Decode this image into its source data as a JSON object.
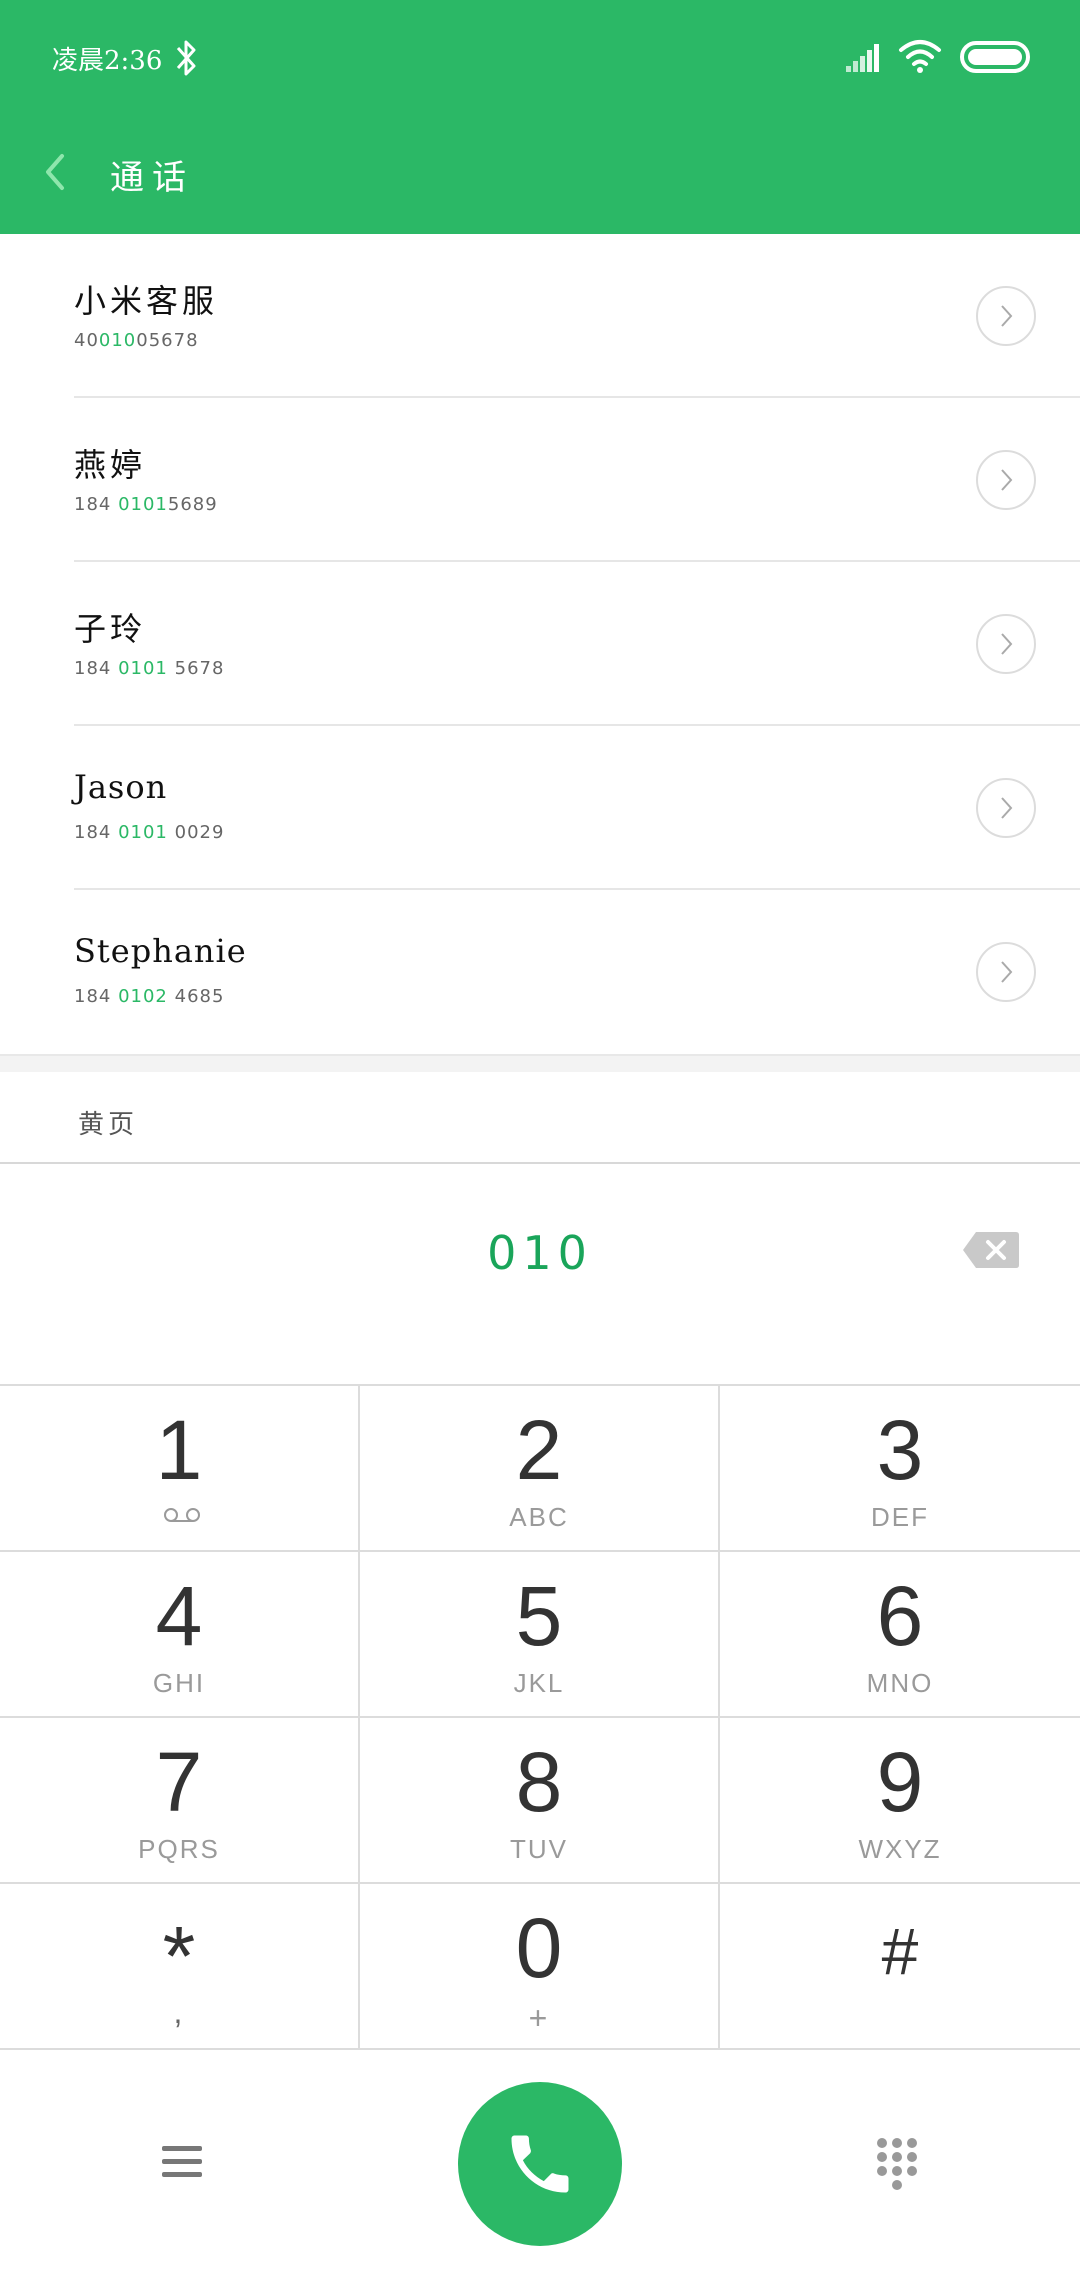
{
  "status_bar": {
    "time": "凌晨2:36",
    "icons": [
      "bluetooth-icon",
      "signal-icon",
      "wifi-icon",
      "battery-icon"
    ]
  },
  "header": {
    "title": "通话",
    "background_color": "#2bb866"
  },
  "contacts": [
    {
      "name": "小米客服",
      "number_parts": [
        "40",
        "010",
        "05678"
      ]
    },
    {
      "name": "燕婷",
      "number_parts": [
        "184 ",
        "0101",
        "5689"
      ]
    },
    {
      "name": "子玲",
      "number_parts": [
        "184 ",
        "0101",
        " 5678"
      ]
    },
    {
      "name": "Jason",
      "number_parts": [
        "184 ",
        "0101",
        " 0029"
      ]
    },
    {
      "name": "Stephanie",
      "number_parts": [
        "184 ",
        "0102",
        " 4685"
      ]
    }
  ],
  "yellow_pages": {
    "label": "黄页"
  },
  "dialer": {
    "dialed_number": "010",
    "accent_color": "#1aa55a"
  },
  "keypad": {
    "keys": [
      {
        "digit": "1",
        "letters": ""
      },
      {
        "digit": "2",
        "letters": "ABC"
      },
      {
        "digit": "3",
        "letters": "DEF"
      },
      {
        "digit": "4",
        "letters": "GHI"
      },
      {
        "digit": "5",
        "letters": "JKL"
      },
      {
        "digit": "6",
        "letters": "MNO"
      },
      {
        "digit": "7",
        "letters": "PQRS"
      },
      {
        "digit": "8",
        "letters": "TUV"
      },
      {
        "digit": "9",
        "letters": "WXYZ"
      },
      {
        "digit": "*",
        "letters": ","
      },
      {
        "digit": "0",
        "letters": "+"
      },
      {
        "digit": "#",
        "letters": ""
      }
    ]
  },
  "bottom_bar": {
    "icons": [
      "menu-icon",
      "phone-icon",
      "dialpad-icon"
    ],
    "call_color": "#2bb866"
  }
}
